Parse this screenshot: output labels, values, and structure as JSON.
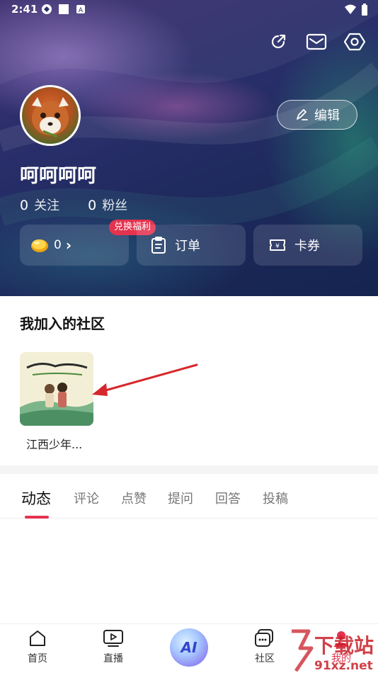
{
  "status_bar": {
    "time": "2:41"
  },
  "profile": {
    "username": "呵呵呵呵",
    "edit_label": "编辑",
    "following_count": "0",
    "following_label": "关注",
    "followers_count": "0",
    "followers_label": "粉丝"
  },
  "cards": {
    "coins_value": "0",
    "coins_chevron": "›",
    "promo_badge": "兑换福利",
    "orders_label": "订单",
    "coupons_label": "卡券"
  },
  "community": {
    "section_title": "我加入的社区",
    "items": [
      {
        "label": "江西少年..."
      }
    ]
  },
  "tabs": {
    "items": [
      {
        "label": "动态"
      },
      {
        "label": "评论"
      },
      {
        "label": "点赞"
      },
      {
        "label": "提问"
      },
      {
        "label": "回答"
      },
      {
        "label": "投稿"
      }
    ],
    "active_index": 0
  },
  "bottom_nav": {
    "items": [
      {
        "label": "首页"
      },
      {
        "label": "直播"
      },
      {
        "label": "AI"
      },
      {
        "label": "社区"
      },
      {
        "label": "我的"
      }
    ]
  },
  "watermark": {
    "text_main": "下载站",
    "text_url": "91xz.net"
  },
  "colors": {
    "accent": "#e5334f",
    "header_dark": "#1f2a5e"
  }
}
